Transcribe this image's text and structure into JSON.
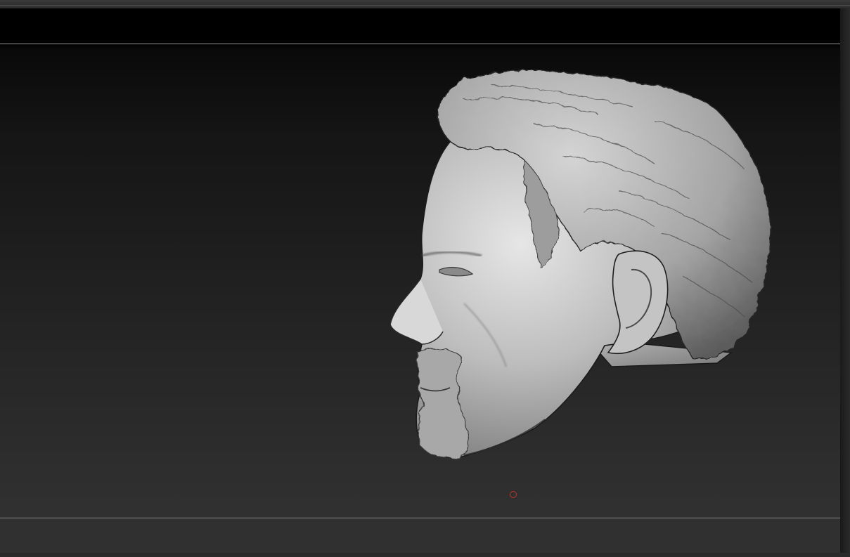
{
  "app": {
    "window_title": ""
  },
  "viewport": {
    "background_top": "#000000",
    "background_bottom": "#333333",
    "model": {
      "name": "",
      "material_color": "#bdbdbd"
    },
    "pivot_marker": {
      "color": "#c0302a"
    }
  }
}
